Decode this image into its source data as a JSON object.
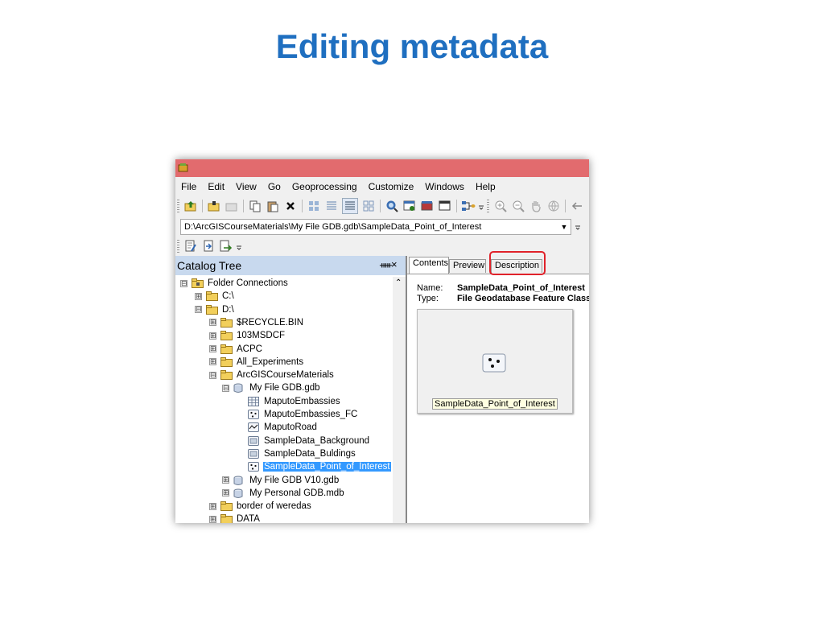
{
  "slide": {
    "title": "Editing metadata"
  },
  "menu": [
    "File",
    "Edit",
    "View",
    "Go",
    "Geoprocessing",
    "Customize",
    "Windows",
    "Help"
  ],
  "location": {
    "path": "D:\\ArcGISCourseMaterials\\My File GDB.gdb\\SampleData_Point_of_Interest"
  },
  "catalog": {
    "title": "Catalog Tree",
    "items": [
      {
        "label": "Folder Connections",
        "expander": "⊟",
        "icon": "folder-connections-icon"
      },
      {
        "label": "C:\\",
        "expander": "⊞",
        "icon": "folder-icon"
      },
      {
        "label": "D:\\",
        "expander": "⊟",
        "icon": "folder-icon"
      },
      {
        "label": "$RECYCLE.BIN",
        "expander": "⊞",
        "icon": "folder-icon"
      },
      {
        "label": "103MSDCF",
        "expander": "⊞",
        "icon": "folder-icon"
      },
      {
        "label": "ACPC",
        "expander": "⊞",
        "icon": "folder-icon"
      },
      {
        "label": "All_Experiments",
        "expander": "⊞",
        "icon": "folder-icon"
      },
      {
        "label": "ArcGISCourseMaterials",
        "expander": "⊟",
        "icon": "folder-icon"
      },
      {
        "label": "My File GDB.gdb",
        "expander": "⊟",
        "icon": "geodatabase-icon"
      },
      {
        "label": "MaputoEmbassies",
        "icon": "table-icon"
      },
      {
        "label": "MaputoEmbassies_FC",
        "icon": "point-feature-class-icon"
      },
      {
        "label": "MaputoRoad",
        "icon": "line-feature-class-icon"
      },
      {
        "label": "SampleData_Background",
        "icon": "raster-icon"
      },
      {
        "label": "SampleData_Buldings",
        "icon": "raster-icon"
      },
      {
        "label": "SampleData_Point_of_Interest",
        "icon": "point-feature-class-icon"
      },
      {
        "label": "My File GDB V10.gdb",
        "expander": "⊞",
        "icon": "geodatabase-icon"
      },
      {
        "label": "My Personal GDB.mdb",
        "expander": "⊞",
        "icon": "geodatabase-icon"
      },
      {
        "label": "border of weredas",
        "expander": "⊞",
        "icon": "folder-icon"
      },
      {
        "label": "DATA",
        "expander": "⊞",
        "icon": "folder-icon"
      }
    ]
  },
  "tabs": [
    "Contents",
    "Preview",
    "Description"
  ],
  "details": {
    "name_label": "Name:",
    "name_value": "SampleData_Point_of_Interest",
    "type_label": "Type:",
    "type_value": "File Geodatabase Feature Class"
  },
  "thumbnail": {
    "caption": "SampleData_Point_of_Interest"
  },
  "colors": {
    "title": "#1f6fc0",
    "titlebar": "#e26b6e",
    "selection": "#3399ff",
    "highlight": "#e0222a"
  }
}
